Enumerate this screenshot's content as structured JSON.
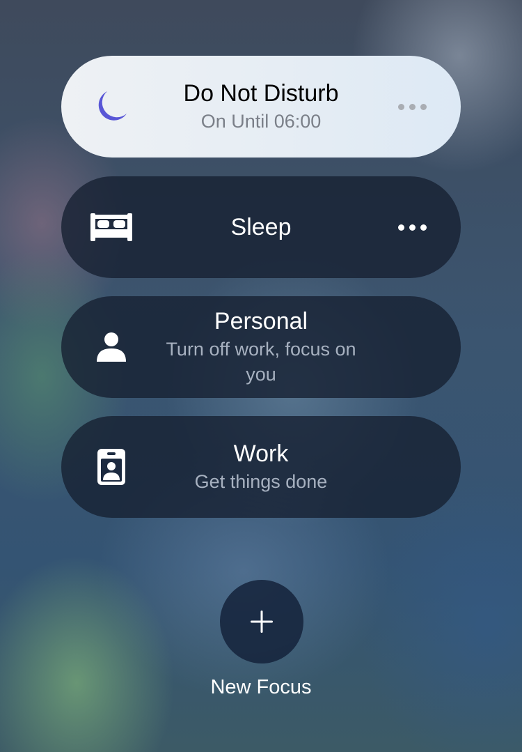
{
  "focus_modes": [
    {
      "title": "Do Not Disturb",
      "subtitle": "On Until 06:00",
      "icon": "moon-icon",
      "active": true
    },
    {
      "title": "Sleep",
      "subtitle": "",
      "icon": "bed-icon",
      "active": false
    },
    {
      "title": "Personal",
      "subtitle": "Turn off work, focus on you",
      "icon": "person-icon",
      "active": false
    },
    {
      "title": "Work",
      "subtitle": "Get things done",
      "icon": "id-badge-icon",
      "active": false
    }
  ],
  "new_focus": {
    "label": "New Focus",
    "icon": "plus-icon"
  },
  "colors": {
    "accent_moon": "#5856d6",
    "active_pill": "#e6edf4",
    "inactive_pill": "#162032"
  }
}
